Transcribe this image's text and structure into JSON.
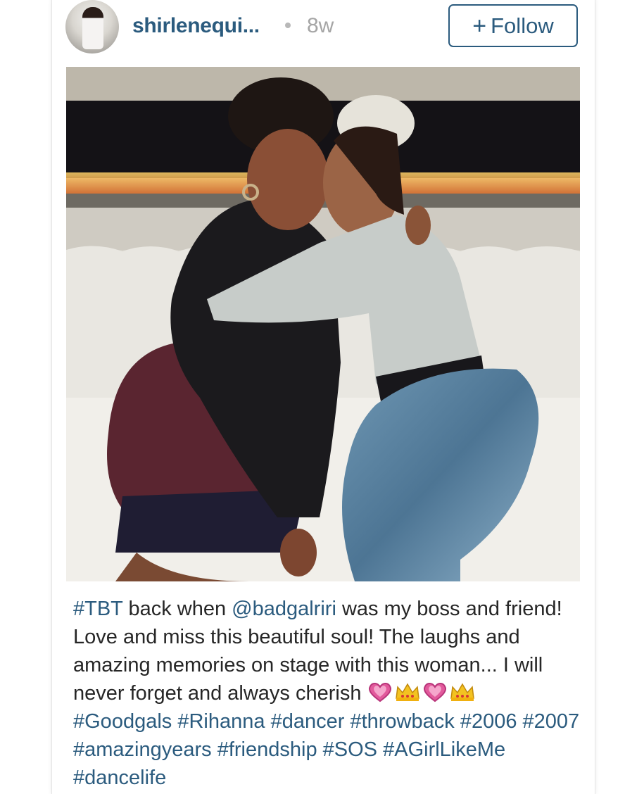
{
  "post": {
    "username": "shirlenequi...",
    "separator": "•",
    "time": "8w",
    "follow": {
      "icon": "plus-icon",
      "plus": "+",
      "label": "Follow"
    }
  },
  "photo": {
    "description_icon": "photo"
  },
  "caption": {
    "tbt": "#TBT",
    "t1": " back when ",
    "mention": "@badgalriri",
    "t2": " was my boss and friend! Love and miss this beautiful soul! The laughs and amazing memories on stage with this woman... I will never forget and always cherish ",
    "emojis": [
      "pink-heart-icon",
      "crown-icon",
      "pink-heart-icon",
      "crown-icon"
    ],
    "tags": [
      "#Goodgals",
      "#Rihanna",
      "#dancer",
      "#throwback",
      "#2006",
      "#2007",
      "#amazingyears",
      "#friendship",
      "#SOS",
      "#AGirlLikeMe",
      "#dancelife"
    ]
  },
  "colors": {
    "link": "#2b5b7e",
    "text": "#262626",
    "muted": "#a5a5a5"
  }
}
